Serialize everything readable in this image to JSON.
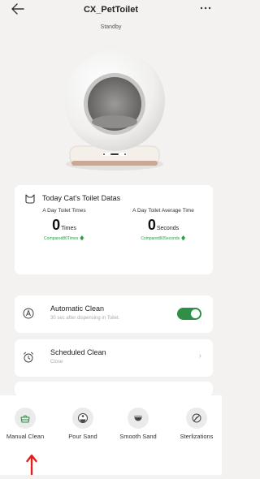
{
  "header": {
    "title": "CX_PetToilet",
    "status": "Standby",
    "back_icon": "arrow-left-icon",
    "more_icon": "more-dots-icon"
  },
  "data_card": {
    "title": "Today Cat's Toilet Datas",
    "toilet_times": {
      "label": "A Day Toilet Times",
      "value": "0",
      "unit": "Times",
      "compared": "Compared80Times"
    },
    "average_time": {
      "label": "A Day Toilet Average Time",
      "value": "0",
      "unit": "Seconds",
      "compared": "Compared605econds"
    }
  },
  "automatic_clean": {
    "title": "Automatic Clean",
    "subtitle": "30 sec after dispensing in Toilet.",
    "enabled": true
  },
  "scheduled_clean": {
    "title": "Scheduled Clean",
    "subtitle": "Close"
  },
  "actions": [
    {
      "label": "Manual Clean",
      "icon": "litter-box-icon"
    },
    {
      "label": "Pour Sand",
      "icon": "pour-sand-icon"
    },
    {
      "label": "Smooth Sand",
      "icon": "smooth-sand-icon"
    },
    {
      "label": "Sterlizations",
      "icon": "sterilization-icon"
    }
  ],
  "colors": {
    "accent_green": "#2f8f46",
    "highlight_red": "#e02020",
    "background": "#f3f2f1"
  }
}
